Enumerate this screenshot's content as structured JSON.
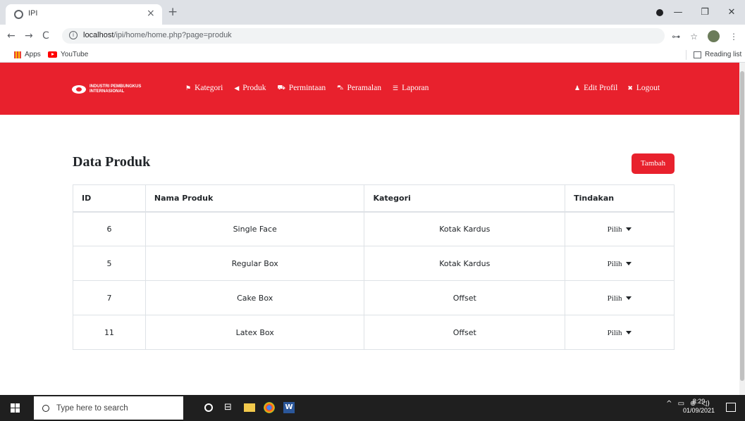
{
  "browser": {
    "tab_title": "IPI",
    "url_host": "localhost",
    "url_path": "/ipi/home/home.php?page=produk",
    "bookmarks": [
      "Apps",
      "YouTube"
    ],
    "reading_list": "Reading list"
  },
  "navbar": {
    "brand_line1": "INDUSTRI PEMBUNGKUS",
    "brand_line2": "INTERNASIONAL",
    "links": [
      {
        "label": "Kategori",
        "icon": "flag-icon"
      },
      {
        "label": "Produk",
        "icon": "bullhorn-icon"
      },
      {
        "label": "Permintaan",
        "icon": "truck-icon"
      },
      {
        "label": "Peramalan",
        "icon": "cart-icon"
      },
      {
        "label": "Laporan",
        "icon": "list-icon"
      }
    ],
    "right_links": [
      {
        "label": "Edit Profil",
        "icon": "user-icon"
      },
      {
        "label": "Logout",
        "icon": "times-icon"
      }
    ],
    "color": "#e8212d"
  },
  "main": {
    "title": "Data Produk",
    "add_button": "Tambah",
    "table": {
      "headers": [
        "ID",
        "Nama Produk",
        "Kategori",
        "Tindakan"
      ],
      "rows": [
        {
          "id": "6",
          "name": "Single Face",
          "category": "Kotak Kardus",
          "action": "Pilih"
        },
        {
          "id": "5",
          "name": "Regular Box",
          "category": "Kotak Kardus",
          "action": "Pilih"
        },
        {
          "id": "7",
          "name": "Cake Box",
          "category": "Offset",
          "action": "Pilih"
        },
        {
          "id": "11",
          "name": "Latex Box",
          "category": "Offset",
          "action": "Pilih"
        }
      ]
    }
  },
  "taskbar": {
    "search_placeholder": "Type here to search",
    "time": "8:29",
    "date": "01/09/2021"
  }
}
